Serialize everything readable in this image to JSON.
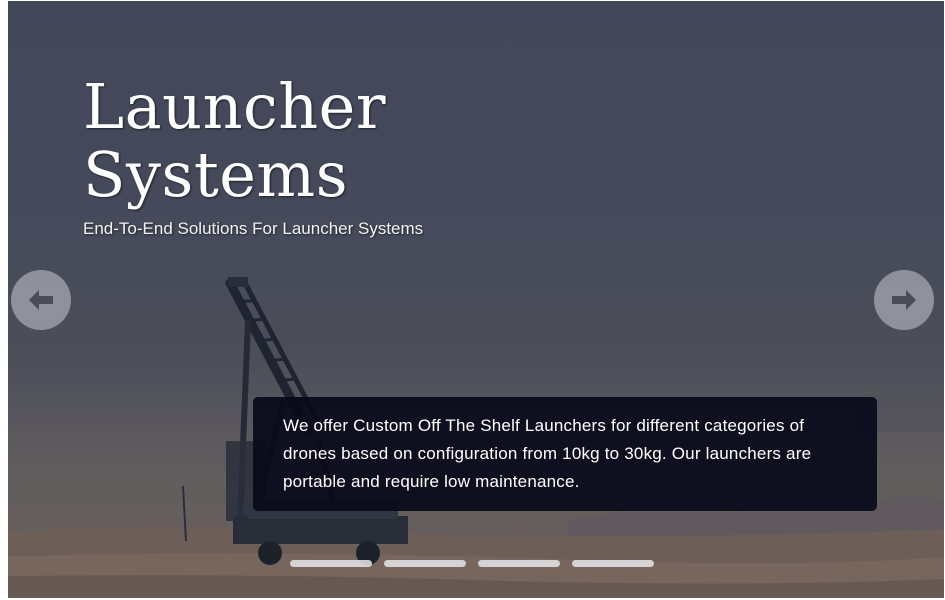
{
  "hero": {
    "title_line1": "Launcher",
    "title_line2": "Systems",
    "subtitle": "End-To-End Solutions For Launcher Systems",
    "caption": "We offer Custom Off The Shelf Launchers for different categories of drones based on configuration from 10kg to 30kg. Our launchers are portable and require low maintenance."
  },
  "navigation": {
    "prev_icon": "arrow-left-icon",
    "next_icon": "arrow-right-icon"
  },
  "indicators": {
    "count": 4
  },
  "colors": {
    "caption_bg": "#080a1a",
    "title_text": "#ffffff",
    "nav_button": "#c8cad2",
    "indicator": "#e6e6e8"
  }
}
